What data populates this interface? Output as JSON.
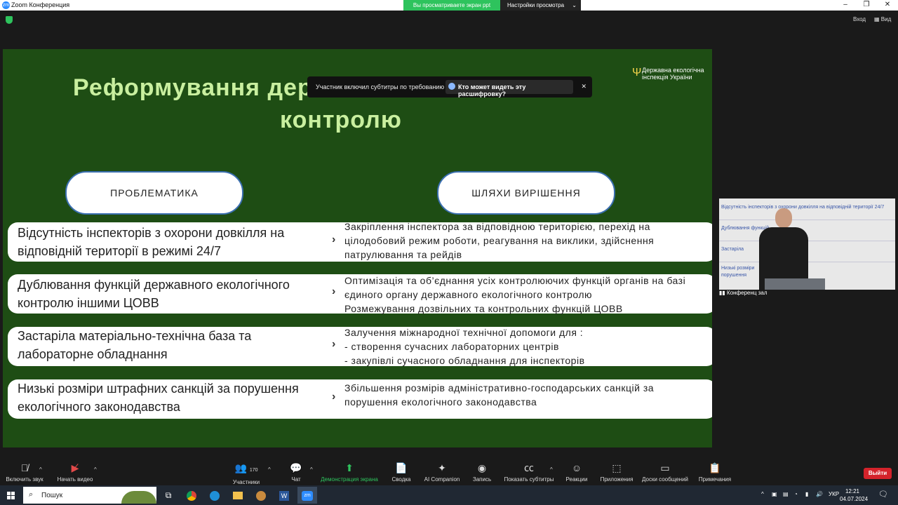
{
  "window": {
    "title": "Zoom Конференция",
    "share_notice": "Вы просматриваете экран ppt",
    "view_settings": "Настройки просмотра"
  },
  "top_bar": {
    "signin": "Вход",
    "view": "Вид"
  },
  "caption_banner": {
    "text": "Участник включил субтитры по требованию",
    "link": "Кто может видеть эту расшифровку?"
  },
  "slide": {
    "title_line1": "Реформування державного екологічного",
    "title_line2": "контролю",
    "logo_text": "Державна екологічна інспекція України",
    "col_left": "ПРОБЛЕМАТИКА",
    "col_right": "ШЛЯХИ ВИРІШЕННЯ",
    "rows": [
      {
        "problem": "Відсутність інспекторів з охорони довкілля на відповідній території в режимі 24/7",
        "solution": "Закріплення інспектора за відповідною територією, перехід на цілодобовий режим роботи, реагування на виклики, здійснення патрулювання та рейдів"
      },
      {
        "problem": "Дублювання функцій державного екологічного контролю іншими ЦОВВ",
        "solution": "Оптимізація та об’єднання усіх контролюючих функцій органів на базі єдиного органу державного екологічного контролю\nРозмежування дозвільних та контрольних функцій ЦОВВ"
      },
      {
        "problem": "Застаріла матеріально-технічна база та лабораторне обладнання",
        "solution": "Залучення міжнародної технічної допомоги для :\n- створення сучасних лабораторних центрів\n - закупівлі сучасного обладнання для інспекторів"
      },
      {
        "problem": "Низькі розміри штрафних санкцій за порушення екологічного законодавства",
        "solution": "Збільшення розмірів адміністративно-господарських санкцій за порушення екологічного законодавства"
      }
    ],
    "arrow": "›"
  },
  "video_tile": {
    "name": "Конференц зал",
    "visible_text": [
      "Відсутність інспекторів з охорони довкілля на відповідній території 24/7",
      "Дублювання функцій",
      "Застаріла",
      "Низькі розміри",
      "порушення"
    ]
  },
  "toolbar": {
    "audio": "Включить звук",
    "video": "Начать видео",
    "participants": "Участники",
    "participants_count": "170",
    "chat": "Чат",
    "share": "Демонстрация экрана",
    "summary": "Сводка",
    "ai": "AI Companion",
    "record": "Запись",
    "captions": "Показать субтитры",
    "reactions": "Реакции",
    "apps": "Приложения",
    "whiteboards": "Доски сообщений",
    "notes": "Примечания",
    "leave": "Выйти"
  },
  "taskbar": {
    "search": "Пошук",
    "lang": "УКР",
    "time": "12:21",
    "date": "04.07.2024"
  }
}
